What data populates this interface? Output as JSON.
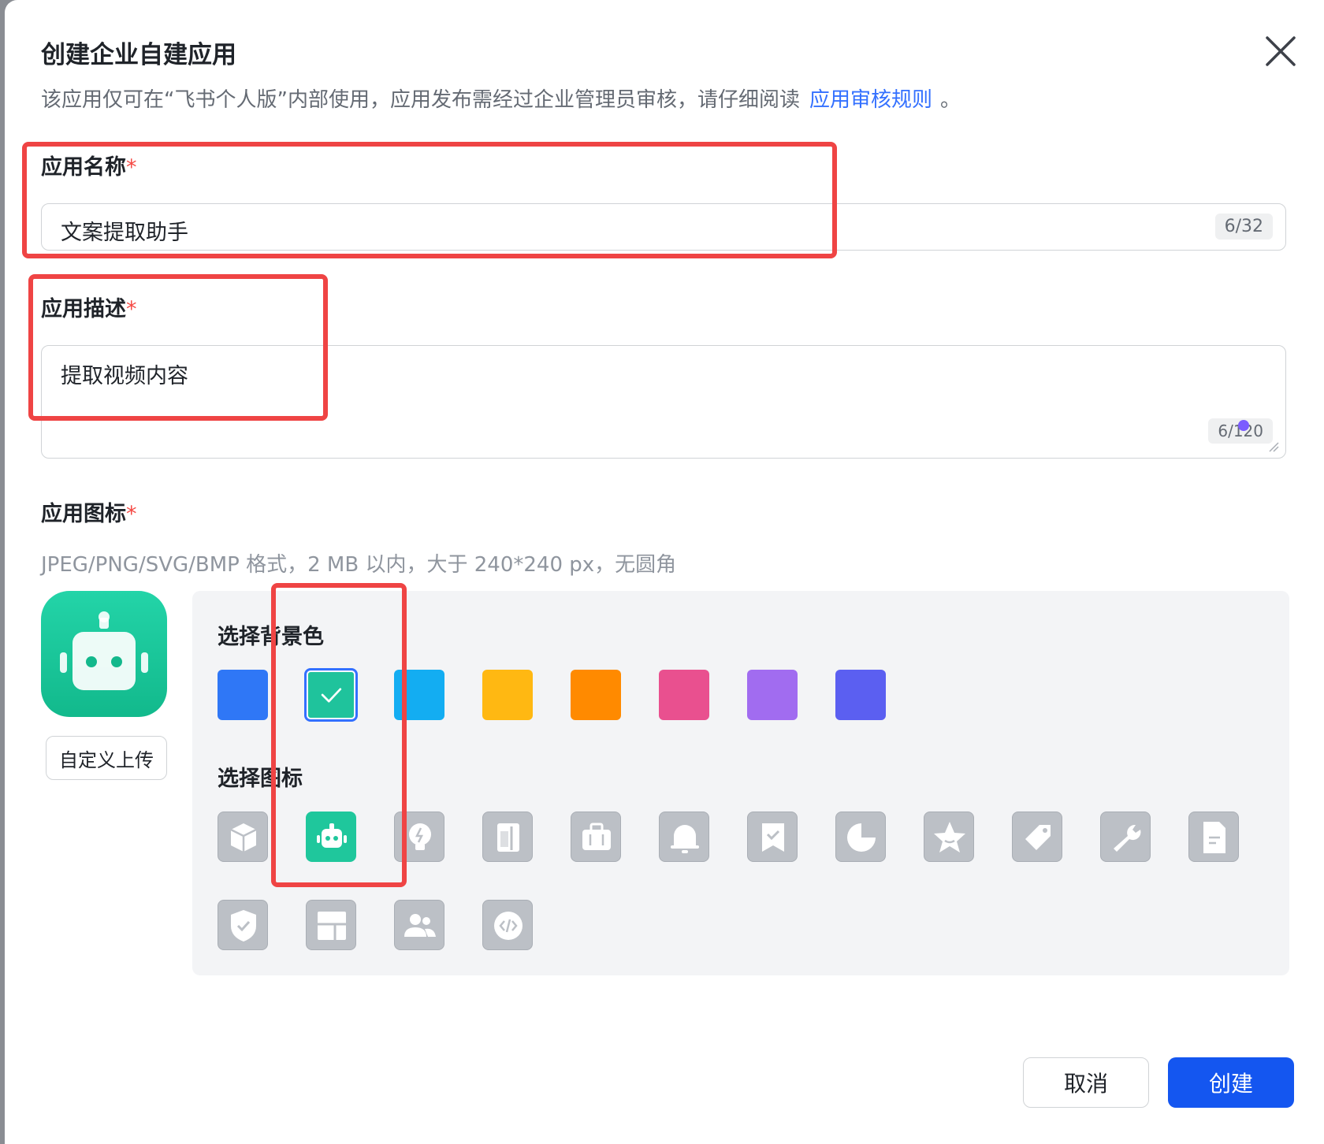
{
  "dialog": {
    "title": "创建企业自建应用",
    "intro_text": "该应用仅可在“飞书个人版”内部使用，应用发布需经过企业管理员审核，请仔细阅读",
    "intro_link": "应用审核规则",
    "intro_period": "。",
    "close_icon": "close-icon"
  },
  "app_name": {
    "label": "应用名称",
    "required_mark": "*",
    "value": "文案提取助手",
    "counter": "6/32"
  },
  "app_description": {
    "label": "应用描述",
    "required_mark": "*",
    "value": "提取视频内容",
    "counter": "6/120"
  },
  "app_icon": {
    "label": "应用图标",
    "required_mark": "*",
    "hint": "JPEG/PNG/SVG/BMP 格式，2 MB 以内，大于 240*240 px，无圆角",
    "custom_upload": "自定义上传",
    "bg_title": "选择背景色",
    "icon_title": "选择图标",
    "background_colors": [
      "#2f77f6",
      "#1fc39c",
      "#13adf2",
      "#ffb812",
      "#ff8a00",
      "#e9508f",
      "#a16cf0",
      "#5b5ff1"
    ],
    "selected_background": "#1fc39c",
    "icons": [
      "cube-icon",
      "robot-icon",
      "lightbulb-icon",
      "book-icon",
      "briefcase-icon",
      "bell-icon",
      "bookmark-icon",
      "pie-chart-icon",
      "star-icon",
      "tag-icon",
      "wrench-icon",
      "document-icon",
      "shield-icon",
      "layout-icon",
      "users-icon",
      "code-icon"
    ],
    "selected_icon": "robot-icon"
  },
  "footer": {
    "cancel": "取消",
    "create": "创建"
  },
  "colors": {
    "primary": "#1456f0",
    "link": "#3370ff",
    "required": "#f54a45",
    "annotation": "#ef4444"
  }
}
